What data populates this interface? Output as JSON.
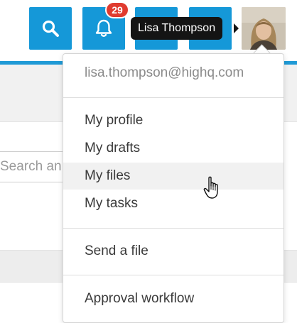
{
  "header": {
    "notification_count": "29",
    "tooltip": "Lisa Thompson",
    "accent_color": "#1f9ad6",
    "badge_color": "#e03b2f"
  },
  "background": {
    "search_placeholder": "Search an"
  },
  "user_menu": {
    "email": "lisa.thompson@highq.com",
    "items": [
      {
        "label": "My profile"
      },
      {
        "label": "My drafts"
      },
      {
        "label": "My files"
      },
      {
        "label": "My tasks"
      }
    ],
    "send_file": "Send a file",
    "approval_workflow": "Approval workflow",
    "hovered_item": "My files"
  },
  "icons": [
    "search-icon",
    "bell-icon",
    "pointer-hand-icon"
  ]
}
